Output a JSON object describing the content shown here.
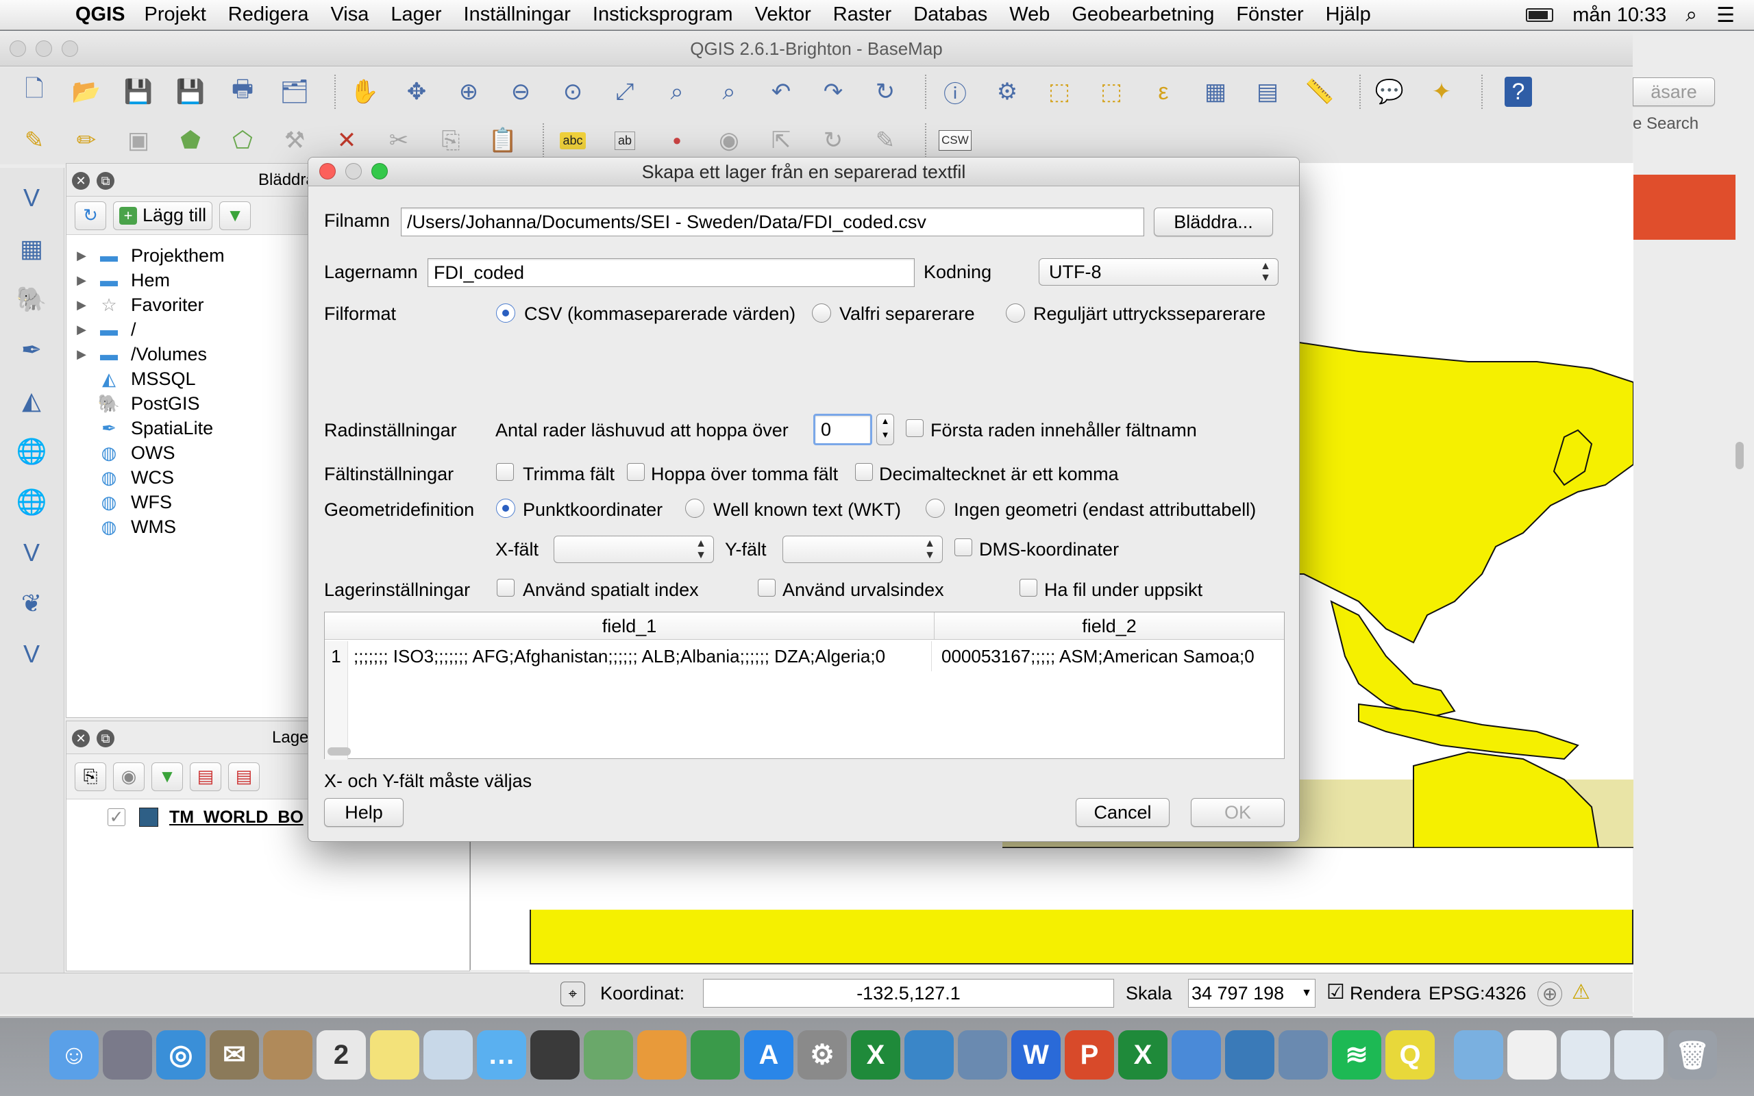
{
  "menubar": {
    "app": "QGIS",
    "items": [
      "Projekt",
      "Redigera",
      "Visa",
      "Lager",
      "Inställningar",
      "Insticksprogram",
      "Vektor",
      "Raster",
      "Databas",
      "Web",
      "Geobearbetning",
      "Fönster",
      "Hjälp"
    ],
    "clock": "mån 10:33"
  },
  "window": {
    "title": "QGIS 2.6.1-Brighton - BaseMap"
  },
  "toolbar1_icons": [
    "new-project-icon",
    "open-project-icon",
    "save-project-icon",
    "save-as-icon",
    "new-print-composer-icon",
    "composer-manager-icon",
    "pan-icon",
    "pan-to-selection-icon",
    "zoom-in-icon",
    "zoom-out-icon",
    "zoom-actual-icon",
    "zoom-full-icon",
    "zoom-to-selection-icon",
    "zoom-to-layer-icon",
    "zoom-last-icon",
    "zoom-next-icon",
    "refresh-icon",
    "identify-icon",
    "action-icon",
    "select-icon",
    "deselect-icon",
    "expression-select-icon",
    "attribute-table-icon",
    "field-calculator-icon",
    "measure-icon",
    "map-tips-icon",
    "new-bookmark-icon",
    "help-icon"
  ],
  "toolbar2": {
    "csw": "CSW",
    "abc": "abc",
    "ab": "ab"
  },
  "browser": {
    "title": "Bläddra",
    "add_label": "Lägg till",
    "items": [
      {
        "label": "Projekthem",
        "arrow": true,
        "icon": "folder-icon"
      },
      {
        "label": "Hem",
        "arrow": true,
        "icon": "folder-icon"
      },
      {
        "label": "Favoriter",
        "arrow": true,
        "icon": "star-icon"
      },
      {
        "label": "/",
        "arrow": true,
        "icon": "folder-icon"
      },
      {
        "label": "/Volumes",
        "arrow": true,
        "icon": "folder-icon"
      },
      {
        "label": "MSSQL",
        "arrow": false,
        "icon": "mssql-icon"
      },
      {
        "label": "PostGIS",
        "arrow": false,
        "icon": "postgis-icon"
      },
      {
        "label": "SpatiaLite",
        "arrow": false,
        "icon": "spatialite-icon"
      },
      {
        "label": "OWS",
        "arrow": false,
        "icon": "ows-icon"
      },
      {
        "label": "WCS",
        "arrow": false,
        "icon": "wcs-icon"
      },
      {
        "label": "WFS",
        "arrow": false,
        "icon": "wfs-icon"
      },
      {
        "label": "WMS",
        "arrow": false,
        "icon": "wms-icon"
      }
    ]
  },
  "layers": {
    "title": "Lage",
    "layer_name": "TM_WORLD_BO"
  },
  "right_partial": {
    "btn": "äsare",
    "search": "e Search"
  },
  "dialog": {
    "title": "Skapa ett lager från en separerad textfil",
    "filnamn_label": "Filnamn",
    "filnamn_value": "/Users/Johanna/Documents/SEI - Sweden/Data/FDI_coded.csv",
    "browse_label": "Bläddra...",
    "lagernamn_label": "Lagernamn",
    "lagernamn_value": "FDI_coded",
    "kodning_label": "Kodning",
    "kodning_value": "UTF-8",
    "filformat_label": "Filformat",
    "format_csv": "CSV (kommaseparerade värden)",
    "format_custom": "Valfri separerare",
    "format_regex": "Reguljärt uttrycksseparerare",
    "rad_label": "Radinställningar",
    "skip_label": "Antal rader läshuvud att hoppa över",
    "skip_value": "0",
    "first_row_label": "Första raden innehåller fältnamn",
    "falt_label": "Fältinställningar",
    "trim_label": "Trimma fält",
    "skip_empty_label": "Hoppa över tomma fält",
    "decimal_label": "Decimaltecknet är ett komma",
    "geom_label": "Geometridefinition",
    "geom_point": "Punktkoordinater",
    "geom_wkt": "Well known text (WKT)",
    "geom_none": "Ingen geometri (endast attributtabell)",
    "x_label": "X-fält",
    "y_label": "Y-fält",
    "dms_label": "DMS-koordinater",
    "lager_label": "Lagerinställningar",
    "spatial_index_label": "Använd spatialt index",
    "subset_index_label": "Använd urvalsindex",
    "watch_label": "Ha fil under uppsikt",
    "table": {
      "headers": [
        "field_1",
        "field_2"
      ],
      "row_num": "1",
      "row": [
        ";;;;;;; ISO3;;;;;;; AFG;Afghanistan;;;;;; ALB;Albania;;;;;; DZA;Algeria;0",
        "000053167;;;;; ASM;American Samoa;0"
      ]
    },
    "status": "X- och Y-fält måste väljas",
    "help_label": "Help",
    "cancel_label": "Cancel",
    "ok_label": "OK"
  },
  "statusbar": {
    "coord_label": "Koordinat:",
    "coord_value": "-132.5,127.1",
    "scale_label": "Skala",
    "scale_value": "34 797 198",
    "render_label": "Rendera",
    "epsg": "EPSG:4326"
  },
  "colors": {
    "land": "#f5f000",
    "accent": "#2a5fc0"
  },
  "dock_icons": [
    "finder-icon",
    "launchpad-icon",
    "safari-icon",
    "mail-icon",
    "contacts-icon",
    "calendar-icon",
    "notes-icon",
    "preview-icon",
    "messages-icon",
    "facetime-icon",
    "iphoto-icon",
    "pages-icon",
    "numbers-icon",
    "app-store-icon",
    "system-preferences-icon",
    "excel-icon",
    "download-icon",
    "network-icon",
    "word-icon",
    "powerpoint-icon",
    "excel-icon",
    "users-icon",
    "globe-icon",
    "network-icon",
    "spotify-icon",
    "qgis-icon",
    "folder-icon",
    "document-icon",
    "window-icon",
    "window-icon",
    "trash-icon"
  ]
}
